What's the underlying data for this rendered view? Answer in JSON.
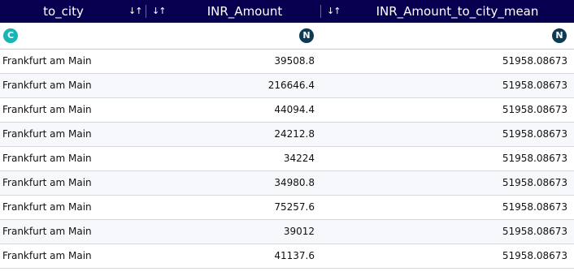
{
  "columns": [
    {
      "title": "to_city",
      "sort_icon": "↓↑",
      "type_badge": "C",
      "type": "categorical"
    },
    {
      "title": "INR_Amount",
      "sort_icon": "↓↑",
      "type_badge": "N",
      "type": "numeric"
    },
    {
      "title": "INR_Amount_to_city_mean",
      "sort_icon": "↓↑",
      "type_badge": "N",
      "type": "numeric"
    }
  ],
  "rows": [
    {
      "to_city": "Frankfurt am Main",
      "inr_amount": "39508.8",
      "inr_amount_mean": "51958.08673"
    },
    {
      "to_city": "Frankfurt am Main",
      "inr_amount": "216646.4",
      "inr_amount_mean": "51958.08673"
    },
    {
      "to_city": "Frankfurt am Main",
      "inr_amount": "44094.4",
      "inr_amount_mean": "51958.08673"
    },
    {
      "to_city": "Frankfurt am Main",
      "inr_amount": "24212.8",
      "inr_amount_mean": "51958.08673"
    },
    {
      "to_city": "Frankfurt am Main",
      "inr_amount": "34224",
      "inr_amount_mean": "51958.08673"
    },
    {
      "to_city": "Frankfurt am Main",
      "inr_amount": "34980.8",
      "inr_amount_mean": "51958.08673"
    },
    {
      "to_city": "Frankfurt am Main",
      "inr_amount": "75257.6",
      "inr_amount_mean": "51958.08673"
    },
    {
      "to_city": "Frankfurt am Main",
      "inr_amount": "39012",
      "inr_amount_mean": "51958.08673"
    },
    {
      "to_city": "Frankfurt am Main",
      "inr_amount": "41137.6",
      "inr_amount_mean": "51958.08673"
    }
  ],
  "colors": {
    "header_bg": "#070051",
    "categorical_badge": "#17b5b5",
    "numeric_badge": "#0d3a54",
    "alt_row_bg": "#f6f8fc"
  }
}
